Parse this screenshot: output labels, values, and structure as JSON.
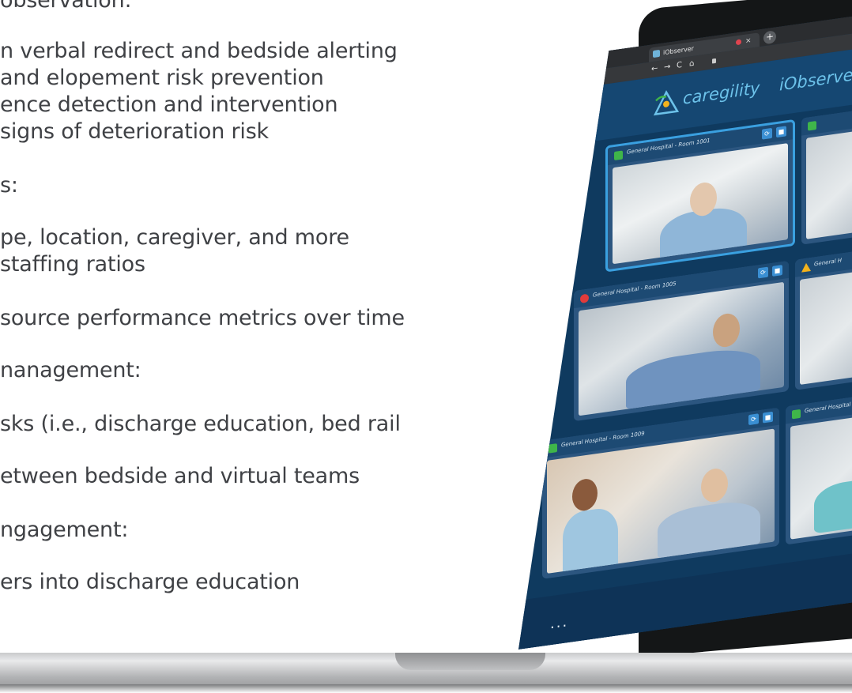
{
  "copy_lines": [
    "observation:",
    "n verbal redirect and bedside alerting",
    "and elopement risk prevention",
    "ence detection and intervention",
    "signs of deterioration risk",
    "s:",
    "pe, location, caregiver, and more",
    "staffing ratios",
    "source performance metrics over time",
    "nanagement:",
    "sks (i.e., discharge education, bed rail",
    "etween bedside and virtual teams",
    "ngagement:",
    "ers into discharge education"
  ],
  "browser": {
    "tab_title": "iObserver",
    "close_glyph": "×",
    "new_tab_glyph": "+",
    "nav_back": "←",
    "nav_forward": "→",
    "nav_reload": "C",
    "nav_home": "⌂"
  },
  "app": {
    "brand": "caregility",
    "product": "iObserver",
    "brand_color": "#6cc2ea",
    "tiles": [
      {
        "room": "General Hospital - Room 1001",
        "status": "green",
        "selected": true
      },
      {
        "room": "",
        "status": "green",
        "selected": false
      },
      {
        "room": "General Hospital - Room 1005",
        "status": "red",
        "selected": false
      },
      {
        "room": "General H",
        "status": "amber",
        "selected": false
      },
      {
        "room": "General Hospital - Room 1009",
        "status": "green",
        "selected": false
      },
      {
        "room": "General Hospital - Roo",
        "status": "green",
        "selected": false
      }
    ],
    "footer_menu": "..."
  },
  "colors": {
    "status_green": "#3fb54a",
    "status_red": "#e23b3b",
    "status_amber": "#f2b21c",
    "selection": "#3aa0e0"
  }
}
